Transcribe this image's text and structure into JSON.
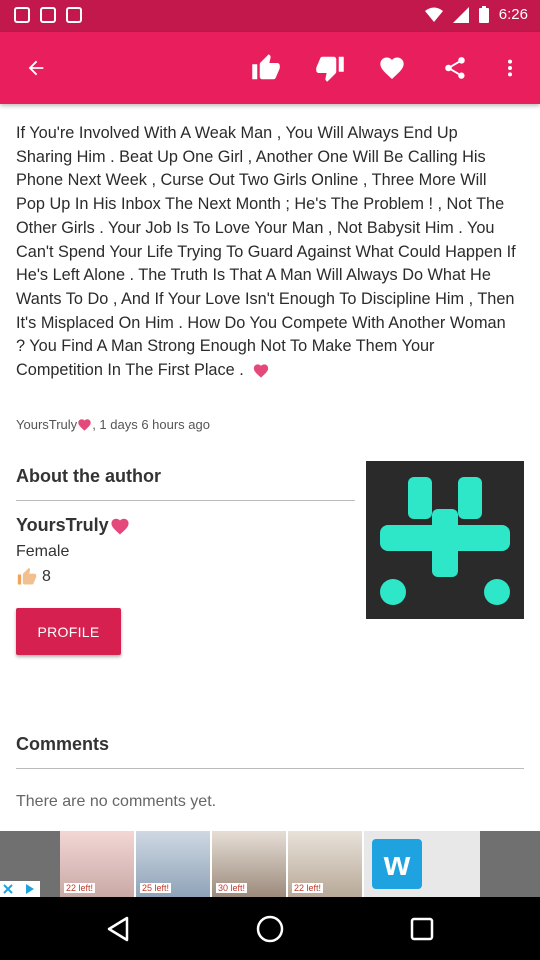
{
  "status_bar": {
    "time": "6:26"
  },
  "quote": {
    "text": "If You're Involved With A Weak Man , You Will Always End Up Sharing Him . Beat Up One Girl , Another One Will Be Calling His Phone Next Week , Curse Out Two Girls Online , Three More Will Pop Up In His Inbox The Next Month ; He's The Problem ! , Not The Other Girls . Your Job Is To Love Your Man , Not Babysit Him . You Can't Spend Your Life Trying To Guard Against What Could Happen If He's Left Alone . The Truth Is That A Man Will Always Do What He Wants To Do , And If Your Love Isn't Enough To Discipline Him , Then It's Misplaced On Him . How Do You Compete With Another Woman ? You Find A Man Strong Enough Not To Make Them Your Competition In The First Place ."
  },
  "meta": {
    "author": "YoursTruly",
    "time_ago": ", 1 days 6 hours ago"
  },
  "about": {
    "title": "About the author",
    "name": "YoursTruly",
    "gender": "Female",
    "likes": "8",
    "profile_label": "PROFILE"
  },
  "comments": {
    "title": "Comments",
    "empty_text": "There are no comments yet."
  },
  "ad": {
    "prices": [
      "22 left!",
      "25 left!",
      "30 left!",
      "22 left!"
    ],
    "brand_letter": "w"
  },
  "colors": {
    "accent": "#e91e5d",
    "status": "#c2184b",
    "heart": "#e5487a",
    "avatar_shape": "#2ee6c8"
  }
}
